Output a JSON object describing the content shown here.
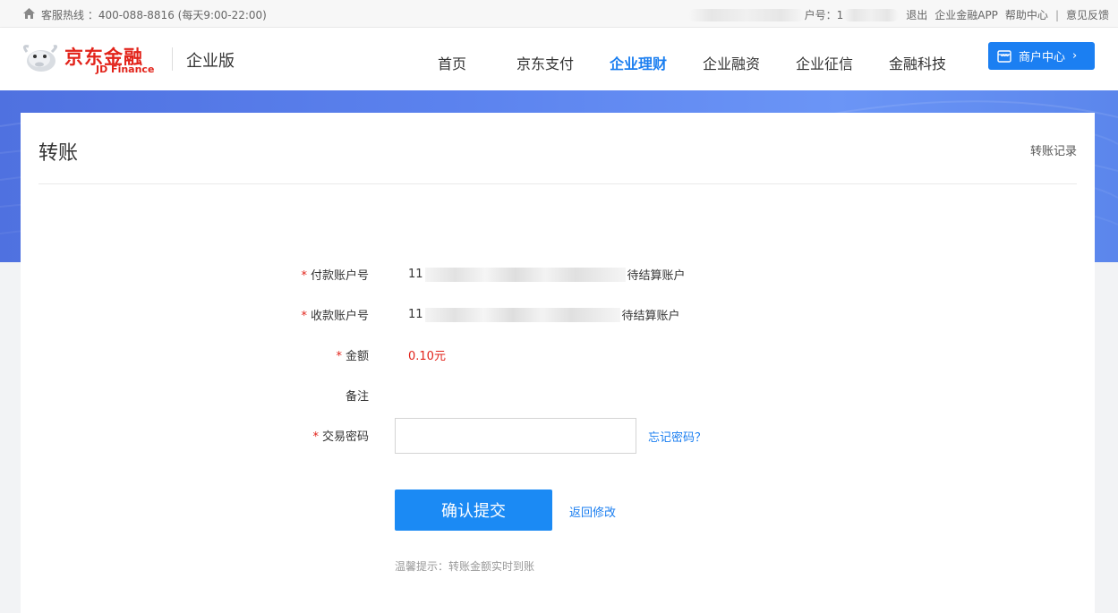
{
  "topbar": {
    "hotline": "客服热线 ：400-088-8816 (每天9:00-22:00)",
    "account_prefix": "户号：1",
    "logout": "退出",
    "app": "企业金融APP",
    "help": "帮助中心",
    "separator": "|",
    "feedback": "意见反馈"
  },
  "header": {
    "logo_cn": "京东金融",
    "logo_en": "JD Finance",
    "edition": "企业版",
    "nav": [
      "首页",
      "京东支付",
      "企业理财",
      "企业融资",
      "企业征信",
      "金融科技"
    ],
    "active_nav": "企业理财",
    "merchant_center": "商户中心"
  },
  "page": {
    "title": "转账",
    "history_link": "转账记录"
  },
  "form": {
    "payer_label": "付款账户号",
    "payer_prefix": "11",
    "payer_suffix": "待结算账户",
    "payee_label": "收款账户号",
    "payee_prefix": "11",
    "payee_suffix": "待结算账户",
    "amount_label": "金额",
    "amount_value": "0.10元",
    "remark_label": "备注",
    "password_label": "交易密码",
    "password_placeholder": "",
    "forgot_password": "忘记密码？",
    "submit": "确认提交",
    "back": "返回修改",
    "tip": "温馨提示：转账金额实时到账",
    "required_mark": "*"
  },
  "colors": {
    "brand_red": "#e2231a",
    "accent_blue": "#1b7ff2",
    "banner_blue": "#5b82ee"
  }
}
